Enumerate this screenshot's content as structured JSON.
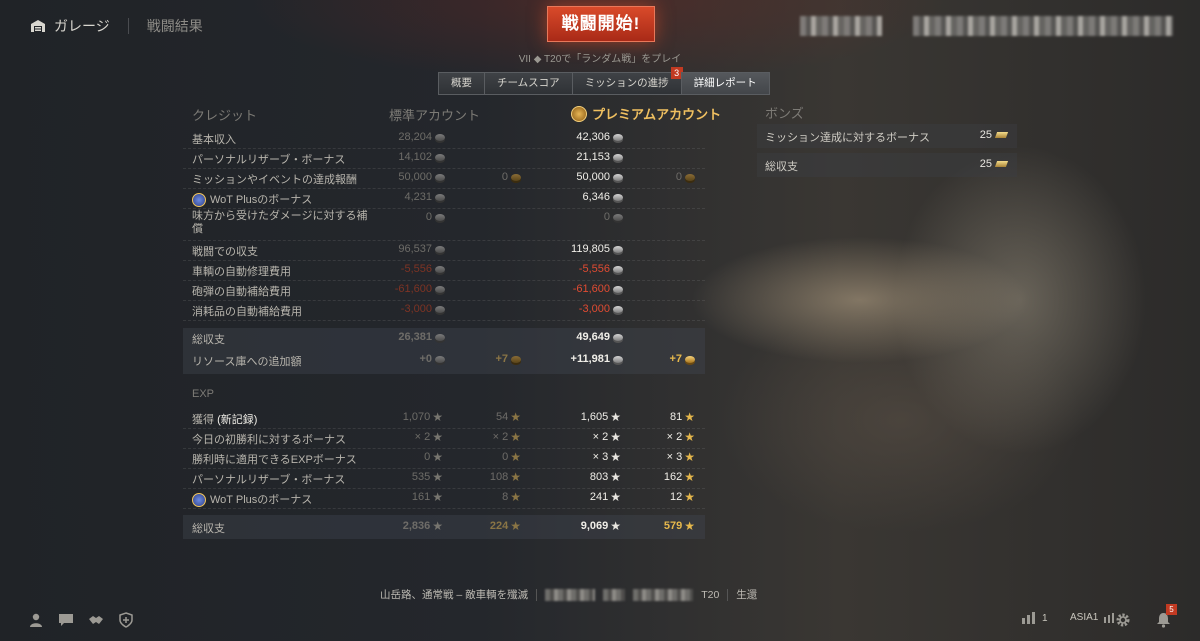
{
  "top": {
    "garage_label": "ガレージ",
    "breadcrumb": "戦闘結果",
    "battle_button": "戦闘開始!",
    "play_info": "VII ◆ T20で「ランダム戦」をプレイ"
  },
  "tabs": [
    {
      "label": "概要"
    },
    {
      "label": "チームスコア"
    },
    {
      "label": "ミッションの進捗",
      "badge": "3"
    },
    {
      "label": "詳細レポート"
    }
  ],
  "credits": {
    "header": "クレジット",
    "standard_header": "標準アカウント",
    "premium_header": "プレミアムアカウント",
    "rows": [
      {
        "label": "基本収入",
        "std": "28,204",
        "prem": "42,306"
      },
      {
        "label": "パーソナルリザーブ・ボーナス",
        "std": "14,102",
        "prem": "21,153"
      },
      {
        "label": "ミッションやイベントの達成報酬",
        "std": "50,000",
        "std_gold": "0",
        "prem": "50,000",
        "prem_gold": "0"
      },
      {
        "label": "WoT Plusのボーナス",
        "std": "4,231",
        "prem": "6,346"
      },
      {
        "label": "味方から受けたダメージに対する補償",
        "std": "0",
        "prem": "0"
      },
      {
        "label": "戦闘での収支",
        "std": "96,537",
        "prem": "119,805"
      },
      {
        "label": "車輌の自動修理費用",
        "std": "-5,556",
        "prem": "-5,556"
      },
      {
        "label": "砲弾の自動補給費用",
        "std": "-61,600",
        "prem": "-61,600"
      },
      {
        "label": "消耗品の自動補給費用",
        "std": "-3,000",
        "prem": "-3,000"
      }
    ],
    "total": {
      "label": "総収支",
      "std": "26,381",
      "prem": "49,649"
    },
    "stash": {
      "label": "リソース庫への追加額",
      "std": "+0",
      "std_gold": "+7",
      "prem": "+11,981",
      "prem_gold": "+7"
    }
  },
  "exp": {
    "header": "EXP",
    "rows": [
      {
        "label": "獲得",
        "label_new": "(新記録)",
        "std": "1,070",
        "std_free": "54",
        "prem": "1,605",
        "prem_free": "81"
      },
      {
        "label": "今日の初勝利に対するボーナス",
        "std": "× 2",
        "std_free": "× 2",
        "prem": "× 2",
        "prem_free": "× 2"
      },
      {
        "label": "勝利時に適用できるEXPボーナス",
        "std": "0",
        "std_free": "0",
        "prem": "× 3",
        "prem_free": "× 3"
      },
      {
        "label": "パーソナルリザーブ・ボーナス",
        "std": "535",
        "std_free": "108",
        "prem": "803",
        "prem_free": "162"
      },
      {
        "label": "WoT Plusのボーナス",
        "std": "161",
        "std_free": "8",
        "prem": "241",
        "prem_free": "12"
      }
    ],
    "total": {
      "label": "総収支",
      "std": "2,836",
      "std_free": "224",
      "prem": "9,069",
      "prem_free": "579"
    }
  },
  "bonds": {
    "header": "ボンズ",
    "rows": [
      {
        "label": "ミッション達成に対するボーナス",
        "value": "25"
      },
      {
        "label": "総収支",
        "value": "25"
      }
    ]
  },
  "footer": {
    "battle_info": "山岳路、通常戦 – 敵車輌を殲滅",
    "tank": "T20",
    "status": "生還"
  },
  "bottom_right": {
    "stats_count": "1",
    "server": "ASIA1",
    "notifications": "5"
  }
}
